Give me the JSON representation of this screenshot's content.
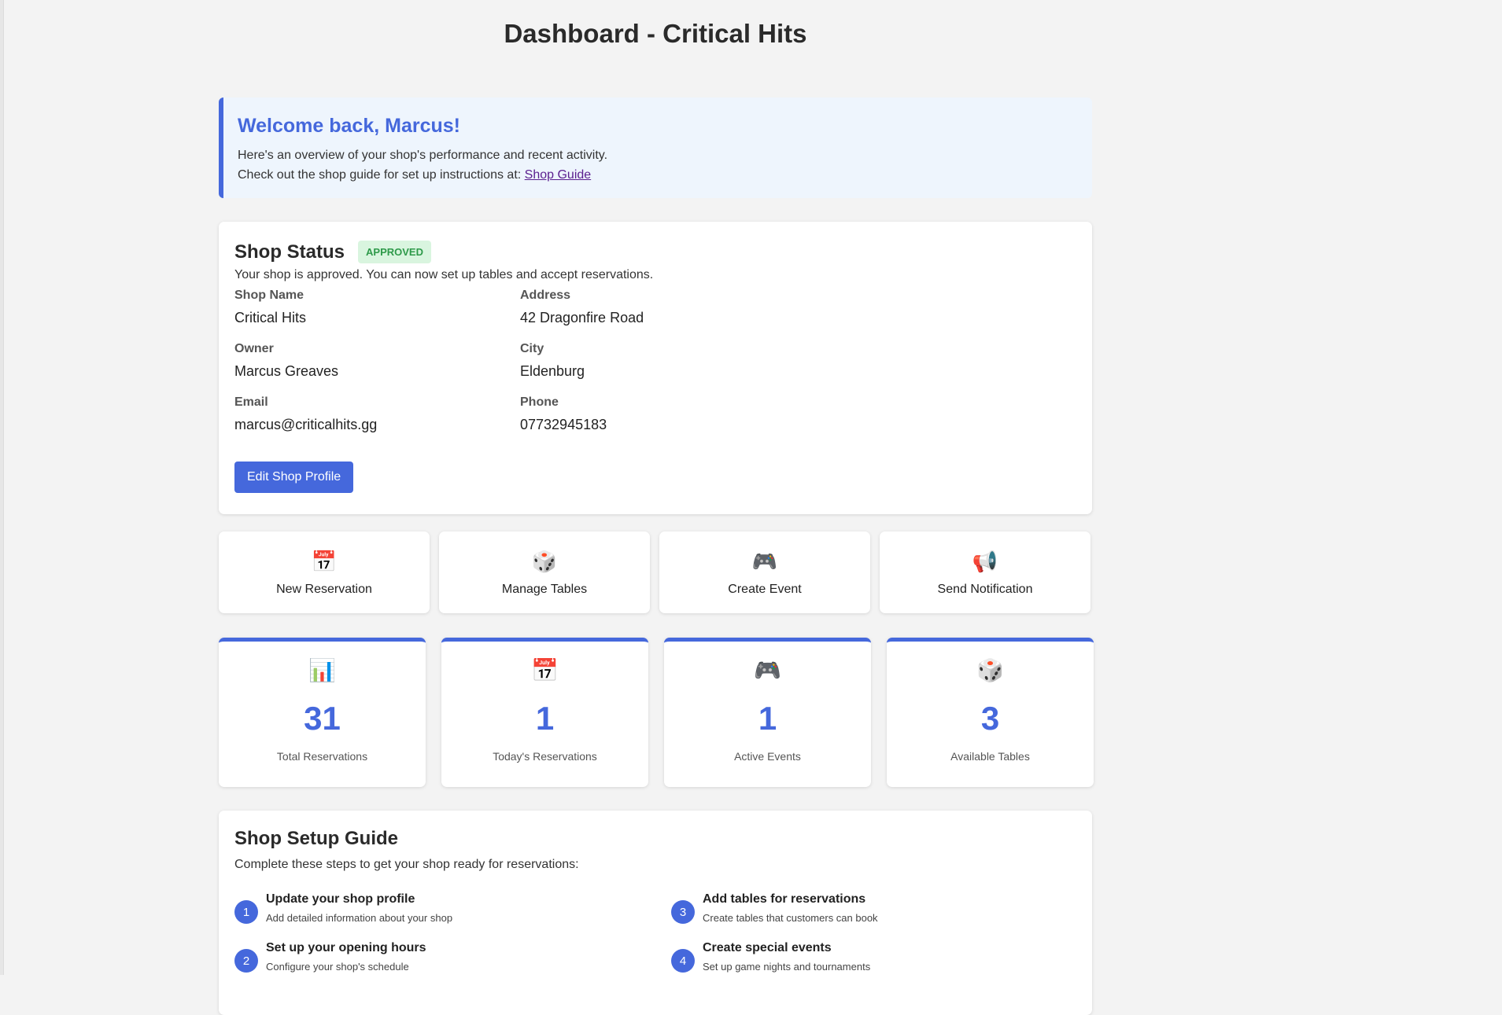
{
  "page": {
    "title": "Dashboard - Critical Hits"
  },
  "welcome": {
    "heading": "Welcome back, Marcus!",
    "line1": "Here's an overview of your shop's performance and recent activity.",
    "line2_prefix": "Check out the shop guide for set up instructions at: ",
    "guide_link": "Shop Guide"
  },
  "shop_status": {
    "heading": "Shop Status",
    "badge": "APPROVED",
    "message": "Your shop is approved. You can now set up tables and accept reservations.",
    "fields": [
      {
        "label": "Shop Name",
        "value": "Critical Hits"
      },
      {
        "label": "Address",
        "value": "42 Dragonfire Road"
      },
      {
        "label": "Owner",
        "value": "Marcus Greaves"
      },
      {
        "label": "City",
        "value": "Eldenburg"
      },
      {
        "label": "Email",
        "value": "marcus@criticalhits.gg"
      },
      {
        "label": "Phone",
        "value": "07732945183"
      }
    ],
    "edit_button": "Edit Shop Profile"
  },
  "quick_actions": [
    {
      "icon": "calendar-icon",
      "glyph": "📅",
      "label": "New Reservation"
    },
    {
      "icon": "dice-icon",
      "glyph": "🎲",
      "label": "Manage Tables"
    },
    {
      "icon": "gamepad-icon",
      "glyph": "🎮",
      "label": "Create Event"
    },
    {
      "icon": "megaphone-icon",
      "glyph": "📢",
      "label": "Send Notification"
    }
  ],
  "stats": [
    {
      "icon": "bar-chart-icon",
      "glyph": "📊",
      "value": "31",
      "label": "Total Reservations"
    },
    {
      "icon": "calendar-icon",
      "glyph": "📅",
      "value": "1",
      "label": "Today's Reservations"
    },
    {
      "icon": "gamepad-icon",
      "glyph": "🎮",
      "value": "1",
      "label": "Active Events"
    },
    {
      "icon": "dice-icon",
      "glyph": "🎲",
      "value": "3",
      "label": "Available Tables"
    }
  ],
  "setup_guide": {
    "heading": "Shop Setup Guide",
    "subtitle": "Complete these steps to get your shop ready for reservations:",
    "steps": [
      {
        "num": "1",
        "title": "Update your shop profile",
        "desc": "Add detailed information about your shop"
      },
      {
        "num": "3",
        "title": "Add tables for reservations",
        "desc": "Create tables that customers can book"
      },
      {
        "num": "2",
        "title": "Set up your opening hours",
        "desc": "Configure your shop's schedule"
      },
      {
        "num": "4",
        "title": "Create special events",
        "desc": "Set up game nights and tournaments"
      }
    ]
  },
  "colors": {
    "accent": "#4568dc",
    "approved_bg": "#d9f5df",
    "approved_text": "#2e9a4a",
    "welcome_bg": "#eef5fd",
    "page_bg": "#f3f3f3"
  }
}
